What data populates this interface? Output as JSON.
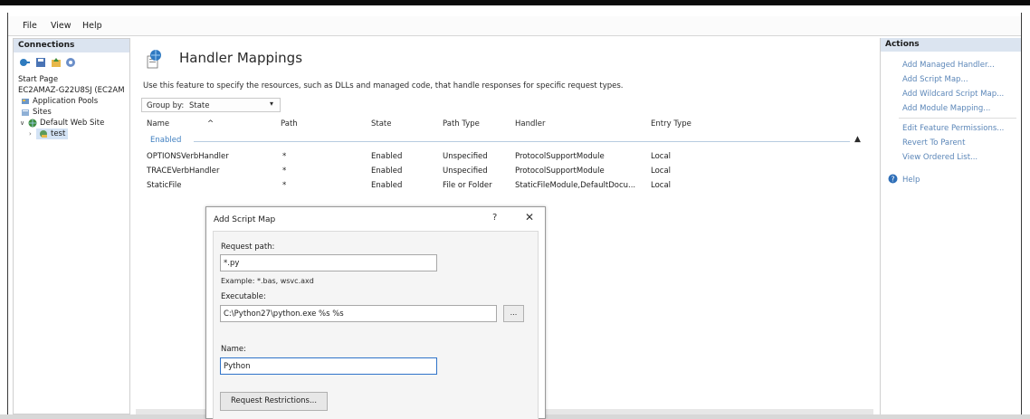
{
  "menu": {
    "file": "File",
    "view": "View",
    "help": "Help"
  },
  "connections": {
    "title": "Connections",
    "tree": [
      {
        "label": "Start Page",
        "icon": "start-page-icon"
      },
      {
        "label": "EC2AMAZ-G22U8SJ (EC2AM",
        "icon": "server-icon"
      },
      {
        "label": "Application Pools",
        "icon": "app-pools-icon"
      },
      {
        "label": "Sites",
        "icon": "sites-folder-icon"
      },
      {
        "label": "Default Web Site",
        "icon": "globe-icon"
      },
      {
        "label": "test",
        "icon": "web-app-icon"
      }
    ]
  },
  "main": {
    "title": "Handler Mappings",
    "description": "Use this feature to specify the resources, such as DLLs and managed code, that handle responses for specific request types.",
    "group_by_label": "Group by:",
    "group_by_value": "State",
    "columns": [
      "Name",
      "Path",
      "State",
      "Path Type",
      "Handler",
      "Entry Type"
    ],
    "group_label": "Enabled",
    "rows": [
      {
        "name": "OPTIONSVerbHandler",
        "path": "*",
        "state": "Enabled",
        "path_type": "Unspecified",
        "handler": "ProtocolSupportModule",
        "entry_type": "Local"
      },
      {
        "name": "TRACEVerbHandler",
        "path": "*",
        "state": "Enabled",
        "path_type": "Unspecified",
        "handler": "ProtocolSupportModule",
        "entry_type": "Local"
      },
      {
        "name": "StaticFile",
        "path": "*",
        "state": "Enabled",
        "path_type": "File or Folder",
        "handler": "StaticFileModule,DefaultDocu...",
        "entry_type": "Local"
      }
    ]
  },
  "actions": {
    "title": "Actions",
    "add_managed_handler": "Add Managed Handler...",
    "add_script_map": "Add Script Map...",
    "add_wildcard_script_map": "Add Wildcard Script Map...",
    "add_module_mapping": "Add Module Mapping...",
    "edit_feature_permissions": "Edit Feature Permissions...",
    "revert_to_parent": "Revert To Parent",
    "view_ordered_list": "View Ordered List...",
    "help": "Help"
  },
  "dialog": {
    "title": "Add Script Map",
    "help_glyph": "?",
    "close_glyph": "✕",
    "request_path_label": "Request path:",
    "request_path_value": "*.py",
    "request_path_example": "Example: *.bas, wsvc.axd",
    "executable_label": "Executable:",
    "executable_value": "C:\\Python27\\python.exe %s %s",
    "browse_label": "...",
    "name_label": "Name:",
    "name_value": "Python",
    "request_restrictions_label": "Request Restrictions..."
  },
  "colors": {
    "link": "#5b86b8",
    "pane_header": "#dbe4f0",
    "group_label": "#3f7fc0",
    "focus_border": "#2f73c9"
  }
}
